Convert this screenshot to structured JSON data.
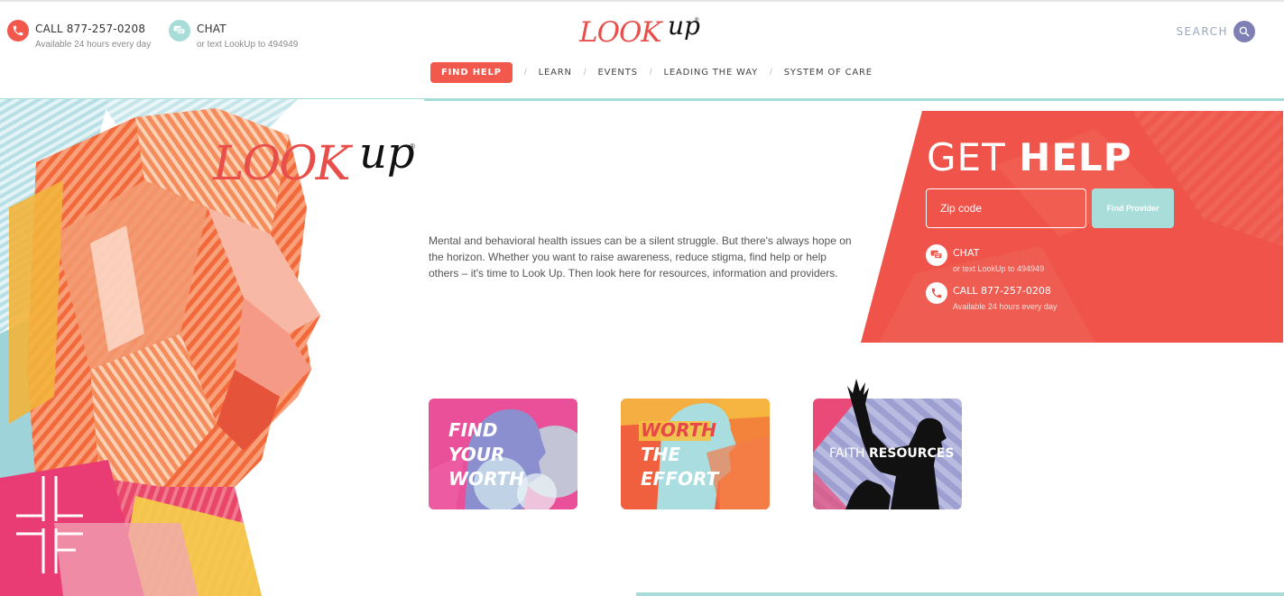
{
  "header": {
    "phone": {
      "label": "CALL 877-257-0208",
      "sub": "Available 24 hours every day"
    },
    "chat": {
      "label": "CHAT",
      "sub": "or text LookUp to 494949"
    },
    "logo": {
      "look": "LOOK",
      "up": "up",
      "reg": "®"
    },
    "search_label": "SEARCH",
    "nav": [
      {
        "label": "FIND HELP",
        "active": true
      },
      {
        "label": "LEARN"
      },
      {
        "label": "EVENTS"
      },
      {
        "label": "LEADING THE WAY"
      },
      {
        "label": "SYSTEM OF CARE"
      }
    ],
    "nav_separator": "/"
  },
  "hero": {
    "logo": {
      "look": "LOOK",
      "up": "up",
      "reg": "®"
    },
    "intro": "Mental and behavioral health issues can be a silent struggle. But there's always hope on the horizon. Whether you want to raise awareness, reduce stigma, find help or help others – it's time to Look Up. Then look here for resources, information and providers."
  },
  "get_help": {
    "title_light": "GET ",
    "title_bold": "HELP",
    "zip_placeholder": "Zip code",
    "find_button": "Find Provider",
    "chat": {
      "label": "CHAT",
      "sub": "or text LookUp to 494949"
    },
    "phone": {
      "label": "CALL 877-257-0208",
      "sub": "Available 24 hours every day"
    }
  },
  "cards": [
    {
      "lines": [
        "FIND",
        "YOUR",
        "WORTH"
      ]
    },
    {
      "lines": [
        "WORTH",
        "THE",
        "EFFORT"
      ]
    },
    {
      "light": "FAITH ",
      "bold": "RESOURCES"
    }
  ],
  "colors": {
    "brand_red": "#e84f4a",
    "nav_active": "#f2584b",
    "teal": "#a8dcd9",
    "search_purple": "#7d7fb5"
  },
  "icons": [
    "phone-icon",
    "chat-icon",
    "search-icon",
    "lf-logo-icon"
  ]
}
